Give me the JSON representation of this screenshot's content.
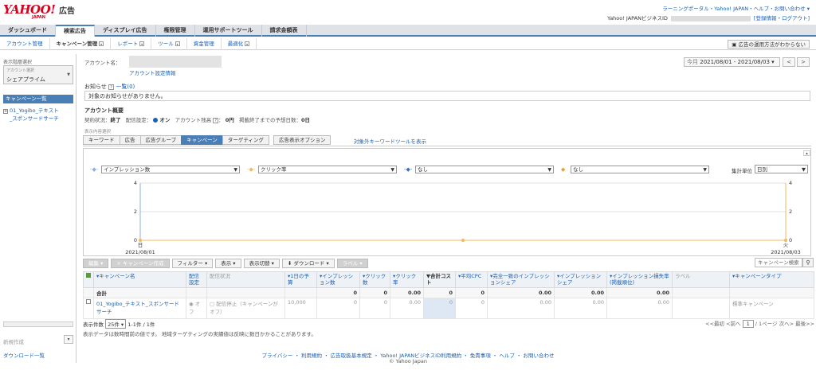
{
  "header": {
    "logo_text": "YAHOO!",
    "logo_sub": "JAPAN",
    "product": "広告",
    "top_links": "ラーニングポータル・Yahoo! JAPAN・ヘルプ・お問い合わせ ▾",
    "biz_id_label": "Yahoo! JAPANビジネスID",
    "biz_id_links": "[登録情報・ログアウト]"
  },
  "tabs": [
    {
      "label": "ダッシュボード"
    },
    {
      "label": "検索広告"
    },
    {
      "label": "ディスプレイ広告"
    },
    {
      "label": "権限管理"
    },
    {
      "label": "運用サポートツール"
    },
    {
      "label": "請求金額表"
    }
  ],
  "subnav": [
    {
      "label": "アカウント管理"
    },
    {
      "label": "キャンペーン管理"
    },
    {
      "label": "レポート"
    },
    {
      "label": "ツール"
    },
    {
      "label": "資金管理"
    },
    {
      "label": "最適化"
    }
  ],
  "help_box": "広告の運用方法がわからない",
  "sidebar": {
    "title": "表示階層選択",
    "account_select_label": "アカウント選択",
    "account_value": "シェアプライム",
    "campaign_list_header": "キャンペーン一覧",
    "tree_item_line1": "01_Yogibo_テキスト",
    "tree_item_line2": "_スポンサードサーチ",
    "new_label": "新規作成",
    "new_btn": "▾",
    "download_list": "ダウンロード一覧"
  },
  "account": {
    "name_label": "アカウント名：",
    "settings_link": "アカウント設定情報",
    "date_prefix": "今月",
    "date_range": "2021/08/01 - 2021/08/03",
    "prev": "<",
    "next": ">"
  },
  "notice": {
    "label": "お知らせ",
    "help": "?",
    "list_link": "一覧(0)",
    "message": "対象のお知らせがありません。"
  },
  "overview": {
    "title": "アカウント概要",
    "contract_label": "契約状況：",
    "contract_value": "終了",
    "delivery_label": "配信設定：",
    "delivery_value": "オン",
    "balance_label": "アカウント残高",
    "balance_value": "0円",
    "days_label": "掲載終了までの予想日数：",
    "days_value": "0日"
  },
  "view_tabs": {
    "label": "表示内容選択",
    "items": [
      "キーワード",
      "広告",
      "広告グループ",
      "キャンペーン",
      "ターゲティング",
      "広告表示オプション"
    ],
    "active": "キャンペーン",
    "kw_tool": "対象外キーワードツールを表示"
  },
  "chart_controls": {
    "metrics": [
      "インプレッション数",
      "クリック率",
      "なし",
      "なし"
    ],
    "metric_colors": [
      "#8aaee0",
      "#f0b860",
      "#3a6fc4",
      "#f0a030"
    ],
    "agg_label": "集計単位",
    "agg_value": "日別"
  },
  "chart_data": {
    "type": "line",
    "categories": [
      "2021/08/01",
      "",
      "2021/08/03"
    ],
    "x_tick_day_labels": [
      "日",
      "",
      "火"
    ],
    "series": [
      {
        "values": [
          0,
          0,
          0
        ],
        "color": "#f0b860"
      }
    ],
    "ylim": [
      0,
      4
    ],
    "y_ticks": [
      "0",
      "2",
      "4"
    ],
    "y2_ticks": [
      "0",
      "2",
      "4"
    ],
    "grid": true
  },
  "toolbar": {
    "edit": "編集 ▾",
    "create": "+ キャンペーン作成",
    "filter": "フィルター ▾",
    "display": "表示 ▾",
    "display_switch": "表示切替 ▾",
    "download": "⬇ ダウンロード ▾",
    "label": "ラベル ▾",
    "search_placeholder": "キャンペーン検索"
  },
  "table": {
    "headers": [
      "",
      "キャンペーン名",
      "配信設定",
      "配信状況",
      "1日の予算",
      "インプレッション数",
      "クリック数",
      "クリック率",
      "合計コスト",
      "平均CPC",
      "完全一致のインプレッションシェア",
      "インプレッションシェア",
      "インプレッション損失率(掲載順位)",
      "ラベル",
      "キャンペーンタイプ"
    ],
    "total_label": "合計",
    "total_values": [
      "",
      "",
      "0",
      "0",
      "0.00",
      "0",
      "0",
      "0.00",
      "0.00",
      "0.00",
      "",
      ""
    ],
    "row": {
      "name": "01_Yogibo_テキスト_スポンサードサーチ",
      "delivery": "オフ",
      "status": "配信停止（キャンペーンがオフ）",
      "budget": "10,000",
      "impressions": "0",
      "clicks": "0",
      "ctr": "0.00",
      "cost": "0",
      "cpc": "0",
      "exact_share": "0.00",
      "share": "0.00",
      "loss": "0.00",
      "label": "",
      "type": "標準キャンペーン"
    }
  },
  "pager": {
    "per_page_label": "表示件数",
    "per_page_value": "25件",
    "range": "1-1件 / 1件",
    "first": "<<最初",
    "prev": "<前へ",
    "page": "1",
    "of": "/ 1ページ",
    "next": "次へ>",
    "last": "最後>>"
  },
  "note": "表示データは数時間前の値です。 地域ターゲティングの実績値は反映に数日かかることがあります。",
  "footer": {
    "links": "プライバシー ・ 利用規約 ・ 広告取扱基本規定 ・ Yahoo! JAPANビジネスID利用規約 ・ 免責事項 ・ ヘルプ ・ お問い合わせ",
    "copyright": "© Yahoo Japan"
  }
}
